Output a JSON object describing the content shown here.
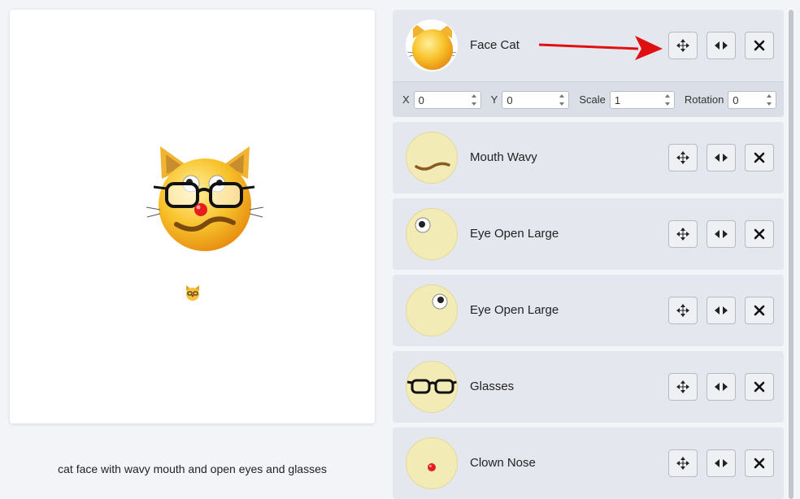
{
  "preview": {
    "caption": "cat face with wavy mouth and open eyes and glasses"
  },
  "layers": [
    {
      "name": "Face Cat",
      "thumb": "cat-face-icon",
      "expanded": true
    },
    {
      "name": "Mouth Wavy",
      "thumb": "wavy-mouth-icon"
    },
    {
      "name": "Eye Open Large",
      "thumb": "eye-open-left-icon"
    },
    {
      "name": "Eye Open Large",
      "thumb": "eye-open-right-icon"
    },
    {
      "name": "Glasses",
      "thumb": "glasses-icon"
    },
    {
      "name": "Clown Nose",
      "thumb": "clown-nose-icon"
    }
  ],
  "properties": {
    "x_label": "X",
    "x_value": "0",
    "y_label": "Y",
    "y_value": "0",
    "scale_label": "Scale",
    "scale_value": "1",
    "rotation_label": "Rotation",
    "rotation_value": "0"
  },
  "buttons": {
    "move_icon": "move-arrows-icon",
    "flip_icon": "flip-horizontal-icon",
    "delete_icon": "close-icon"
  },
  "colors": {
    "accent_arrow": "#e01010",
    "layer_bg": "#e4e7ee",
    "thumb_bg": "#f2ebb5"
  }
}
